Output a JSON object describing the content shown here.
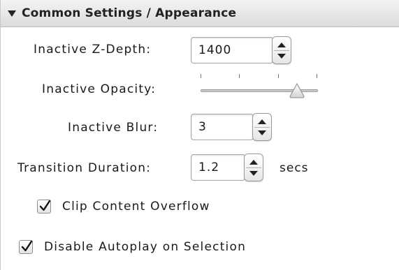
{
  "section": {
    "title": "Common Settings / Appearance",
    "expanded": true
  },
  "fields": {
    "inactive_z_depth": {
      "label": "Inactive Z-Depth:",
      "value": "1400"
    },
    "inactive_opacity": {
      "label": "Inactive Opacity:",
      "value_fraction": 0.82,
      "tick_count": 4
    },
    "inactive_blur": {
      "label": "Inactive Blur:",
      "value": "3"
    },
    "transition_duration": {
      "label": "Transition Duration:",
      "value": "1.2",
      "unit": "secs"
    }
  },
  "checkboxes": {
    "clip_content_overflow": {
      "label": "Clip Content Overflow",
      "checked": true
    },
    "disable_autoplay": {
      "label": "Disable Autoplay on Selection",
      "checked": true
    }
  },
  "icons": [
    "disclosure-triangle-icon",
    "stepper-up-icon",
    "stepper-down-icon",
    "checkmark-icon",
    "slider-thumb-icon"
  ]
}
